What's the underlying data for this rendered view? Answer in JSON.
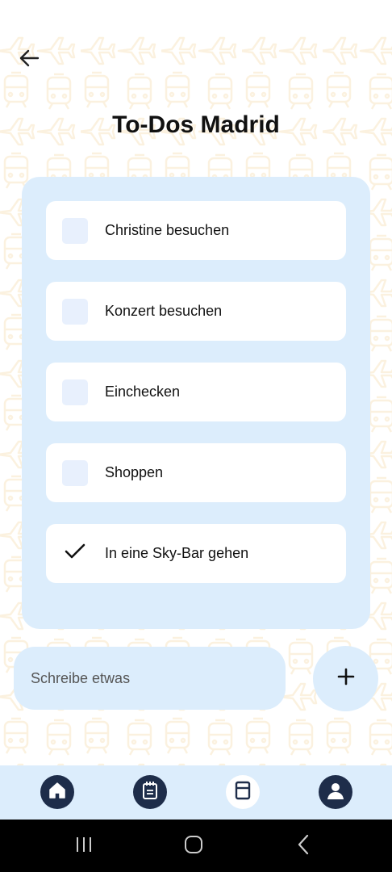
{
  "header": {
    "back_icon": "arrow-left-icon",
    "title": "To-Dos Madrid"
  },
  "todos": [
    {
      "label": "Christine besuchen",
      "checked": false
    },
    {
      "label": "Konzert besuchen",
      "checked": false
    },
    {
      "label": "Einchecken",
      "checked": false
    },
    {
      "label": "Shoppen",
      "checked": false
    },
    {
      "label": "In eine Sky-Bar gehen",
      "checked": true
    }
  ],
  "composer": {
    "placeholder": "Schreibe etwas",
    "add_icon": "plus-icon"
  },
  "bottom_nav": {
    "items": [
      {
        "icon": "home-icon",
        "active": true
      },
      {
        "icon": "notepad-icon",
        "active": true
      },
      {
        "icon": "document-icon",
        "active": false
      },
      {
        "icon": "profile-icon",
        "active": true
      }
    ]
  },
  "system_nav": {
    "items": [
      "recent-apps-icon",
      "home-circle-icon",
      "back-chevron-icon"
    ]
  },
  "colors": {
    "panel": "#dcedfc",
    "checkbox": "#e8f0fd",
    "nav_active": "#1e2d4a",
    "pattern": "#f0c470"
  }
}
